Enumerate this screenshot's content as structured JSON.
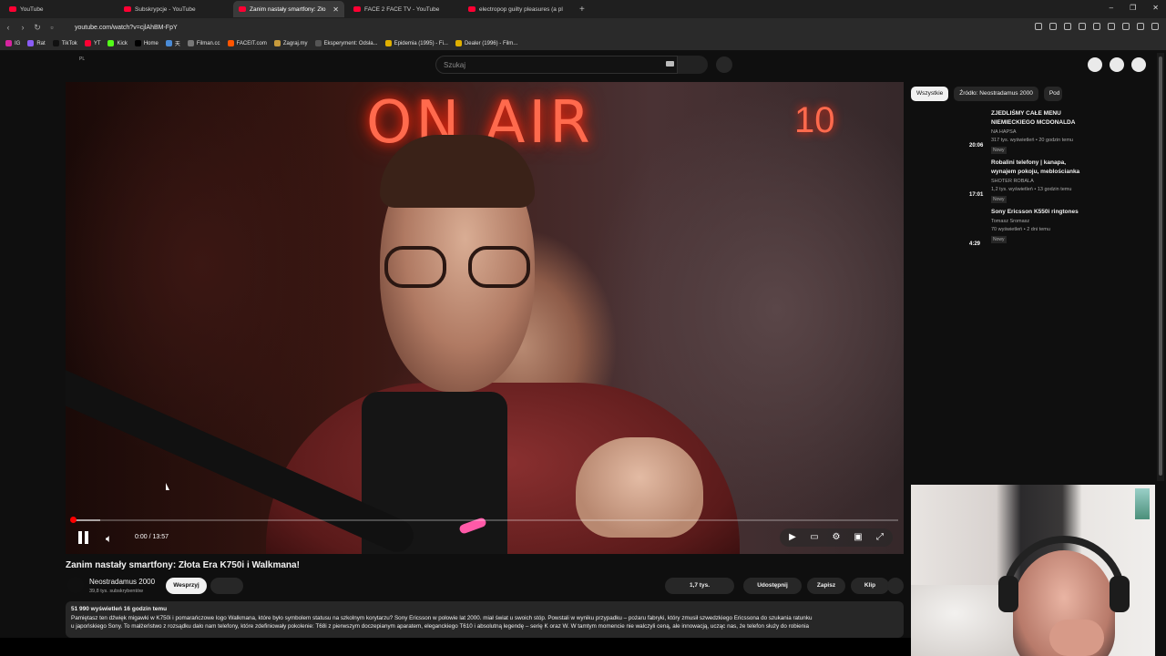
{
  "browser": {
    "tabs": [
      {
        "label": "YouTube",
        "active": false
      },
      {
        "label": "Subskrypcje - YouTube",
        "active": false
      },
      {
        "label": "Zanim nastały smartfony: Zło",
        "active": true
      },
      {
        "label": "FACE 2 FACE TV - YouTube",
        "active": false
      },
      {
        "label": "electropop guilty pleasures (a pl",
        "active": false
      }
    ],
    "new_tab": "+",
    "url": "youtube.com/watch?v=cjlAhBM-FpY",
    "bookmarks": [
      "IG",
      "Rat",
      "TikTok",
      "YT",
      "Kick",
      "Home",
      "天",
      "Filman.cc",
      "FACEIT.com",
      "Zagraj.my",
      "Eksperyment: Odsła...",
      "Epidemia (1995) - Fi...",
      "Dealer (1996) - Film..."
    ],
    "window_controls": [
      "–",
      "❐",
      "✕"
    ]
  },
  "youtube": {
    "region_badge": "PL",
    "search_placeholder": "Szukaj"
  },
  "player": {
    "overlay_text_main": "ON AIR",
    "overlay_text_side": "10",
    "time": "0:00 / 13:57",
    "progress_fraction": 0.0,
    "buffered_fraction": 0.035
  },
  "video": {
    "title": "Zanim nastały smartfony: Złota Era K750i i Walkmana!",
    "channel": "Neostradamus 2000",
    "subscribers": "39,8 tys. subskrybentów",
    "support_label": "Wesprzyj",
    "likes": "1,7 tys.",
    "share_label": "Udostępnij",
    "save_label": "Zapisz",
    "clip_label": "Klip",
    "description_meta": "51 990 wyświetleń  16 godzin temu",
    "description_line1": "Pamiętasz ten dźwięk migawki w K750i i pomarańczowe logo Walkmana, które było symbolem statusu na szkolnym korytarzu? Sony Ericsson w połowie lat 2000. miał świat u swoich stóp. Powstali w wyniku przypadku – pożaru fabryki, który zmusił szwedzkiego Ericssona do szukania ratunku",
    "description_line2": "u japońskiego Sony. To małżeństwo z rozsądku dało nam telefony, które zdefiniowały pokolenie: T68i z pierwszym doczepianym aparatem, eleganckiego T610 i absolutną legendę – serię K oraz W. W tamtym momencie nie walczyli ceną, ale innowacją, ucząc nas, że telefon służy do robienia"
  },
  "sidebar": {
    "chips": [
      "Wszystkie",
      "Źródło: Neostradamus 2000",
      "Pod"
    ],
    "recommendations": [
      {
        "title": "ZJEDLIŚMY CAŁE MENU NIEMIECKIEGO MCDONALDA",
        "channel": "NA HAPSA",
        "meta": "317 tys. wyświetleń • 20 godzin temu",
        "badge": "Nowy",
        "duration": "20:06"
      },
      {
        "title": "Robalini telefony | kanapa, wynajem pokoju, meblościanka",
        "channel": "SHOTER ROBALA",
        "meta": "1,2 tys. wyświetleń • 13 godzin temu",
        "badge": "Nowy",
        "duration": "17:01"
      },
      {
        "title": "Sony Ericsson K550i ringtones",
        "channel": "Tomasz Sromasz",
        "meta": "70 wyświetleń • 2 dni temu",
        "badge": "Nowy",
        "duration": "4:29"
      }
    ]
  },
  "colors": {
    "brand_red": "#ff0000",
    "background": "#0f0f0f",
    "chip_bg": "#272727"
  }
}
